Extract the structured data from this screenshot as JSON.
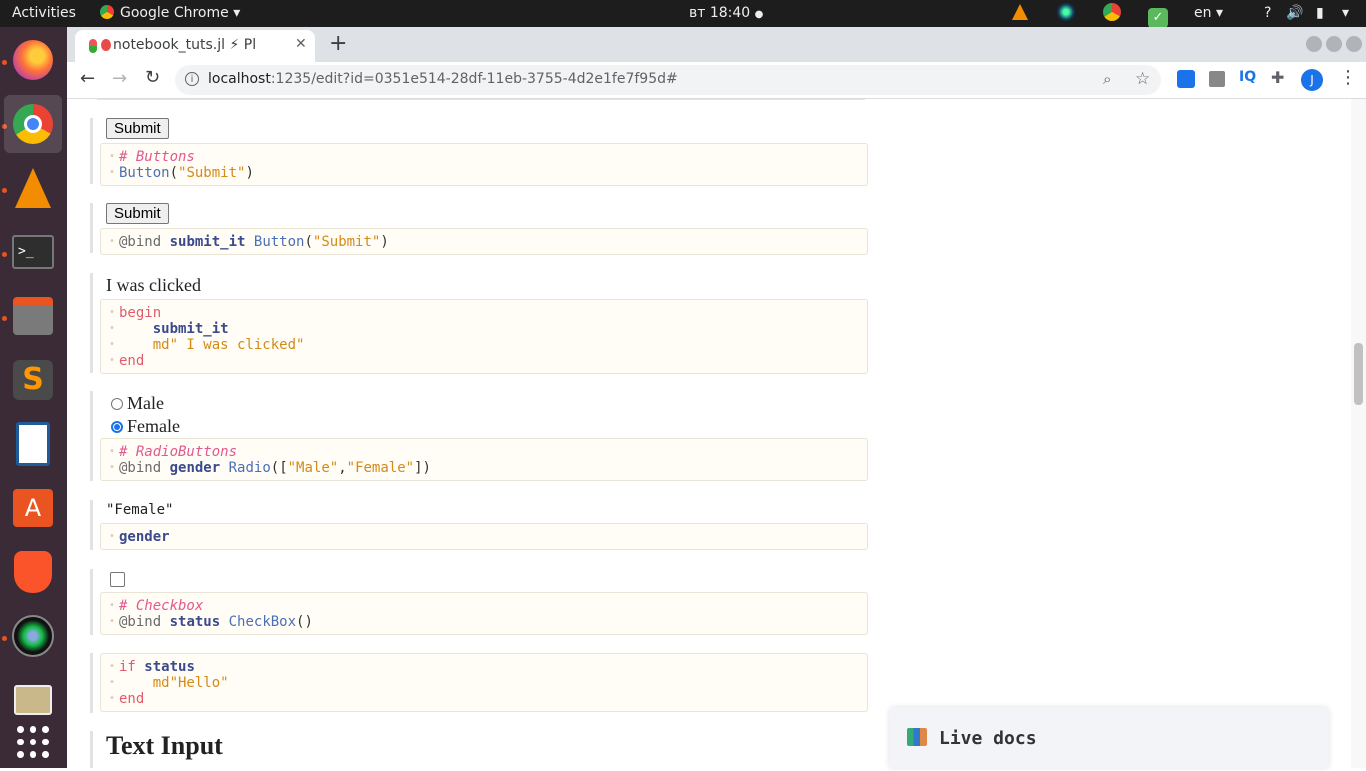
{
  "topbar": {
    "activities": "Activities",
    "app_name": "Google Chrome",
    "clock": "вт 18:40",
    "lang": "en",
    "help": "?"
  },
  "dock": {
    "items": [
      "firefox-icon",
      "chrome-icon",
      "vlc-icon",
      "terminal-icon",
      "files-icon",
      "sublime-icon",
      "writer-icon",
      "software-icon",
      "brave-icon",
      "camera-icon",
      "photos-icon",
      "apps-grid-icon"
    ]
  },
  "browser": {
    "tab_title": "notebook_tuts.jl ⚡ Pl",
    "url_host": "localhost",
    "url_path": ":1235/edit?id=0351e514-28df-11eb-3755-4d2e1fe7f95d#",
    "profile_initial": "J",
    "ext_iq": "IQ"
  },
  "cells": {
    "c1": {
      "button": "Submit",
      "lines": [
        "# Buttons",
        "Button",
        "(",
        "\"Submit\"",
        ")"
      ]
    },
    "c2": {
      "button": "Submit",
      "macro": "@bind",
      "var": "submit_it",
      "fn": "Button",
      "open": "(",
      "str": "\"Submit\"",
      "close": ")"
    },
    "c3": {
      "output": "I was clicked",
      "l1": "begin",
      "l2": "    submit_it",
      "l3a": "    md",
      "l3b": "\" I was clicked\"",
      "l4": "end"
    },
    "c4": {
      "opt1": "Male",
      "opt2": "Female",
      "comment": "# RadioButtons",
      "macro": "@bind",
      "var": "gender",
      "fn": "Radio",
      "open": "([",
      "s1": "\"Male\"",
      "comma": ",",
      "s2": "\"Female\"",
      "close": "])"
    },
    "c5": {
      "output": "\"Female\"",
      "var": "gender"
    },
    "c6": {
      "comment": "# Checkbox",
      "macro": "@bind",
      "var": "status",
      "fn": "CheckBox",
      "paren": "()"
    },
    "c7": {
      "l1a": "if",
      "l1b": "status",
      "l2": "    md\"Hello\"",
      "l3": "end"
    },
    "heading": "Text Input"
  },
  "livedocs": {
    "title": "Live docs"
  }
}
